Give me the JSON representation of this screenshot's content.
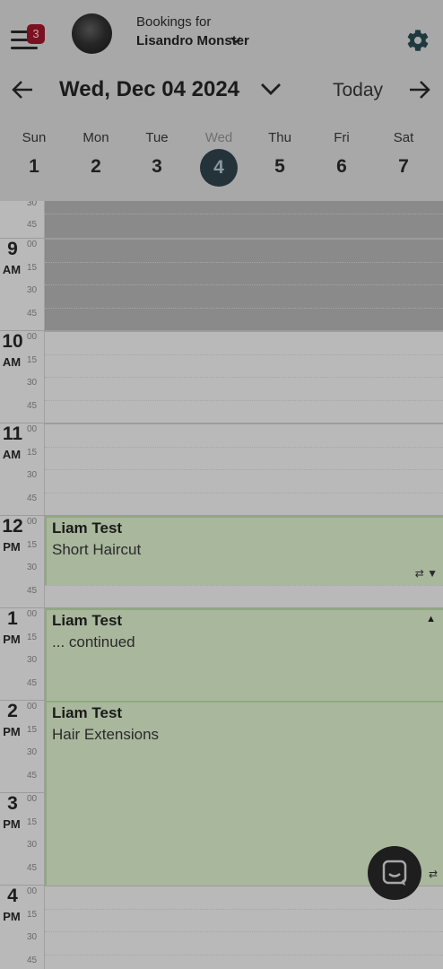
{
  "header": {
    "badge_count": "3",
    "bookings_label": "Bookings for",
    "owner_name": "Lisandro Monster"
  },
  "date_nav": {
    "current_date": "Wed, Dec 04 2024",
    "today_label": "Today"
  },
  "week": {
    "days": [
      {
        "name": "Sun",
        "num": "1"
      },
      {
        "name": "Mon",
        "num": "2"
      },
      {
        "name": "Tue",
        "num": "3"
      },
      {
        "name": "Wed",
        "num": "4"
      },
      {
        "name": "Thu",
        "num": "5"
      },
      {
        "name": "Fri",
        "num": "6"
      },
      {
        "name": "Sat",
        "num": "7"
      }
    ],
    "selected_day": "Wed"
  },
  "grid": {
    "minute_labels": [
      "00",
      "15",
      "30",
      "45"
    ],
    "top_partial_labels": [
      "30",
      "45"
    ],
    "hours": [
      {
        "hour": "9",
        "ampm": "AM"
      },
      {
        "hour": "10",
        "ampm": "AM"
      },
      {
        "hour": "11",
        "ampm": "AM"
      },
      {
        "hour": "12",
        "ampm": "PM"
      },
      {
        "hour": "1",
        "ampm": "PM"
      },
      {
        "hour": "2",
        "ampm": "PM"
      },
      {
        "hour": "3",
        "ampm": "PM"
      },
      {
        "hour": "4",
        "ampm": "PM"
      }
    ]
  },
  "appointments": [
    {
      "client": "Liam Test",
      "service": "Short Haircut",
      "start": "12:00",
      "end": "12:45",
      "icons": "⇄ ▼"
    },
    {
      "client": "Liam Test",
      "service": "... continued",
      "start": "13:00",
      "end": "14:00",
      "icons": "▲"
    },
    {
      "client": "Liam Test",
      "service": "Hair Extensions",
      "start": "14:00",
      "end": "16:00",
      "icons": "⇄"
    }
  ],
  "colors": {
    "appointment_fill": "#a9b79d",
    "closed_fill": "#8a8a8a",
    "badge": "#7a1020",
    "selected_day": "#24323a"
  },
  "icons": [
    "menu-icon",
    "gear-icon",
    "arrow-left-icon",
    "chevron-down-icon",
    "arrow-right-icon",
    "chat-icon",
    "repeat-icon"
  ]
}
